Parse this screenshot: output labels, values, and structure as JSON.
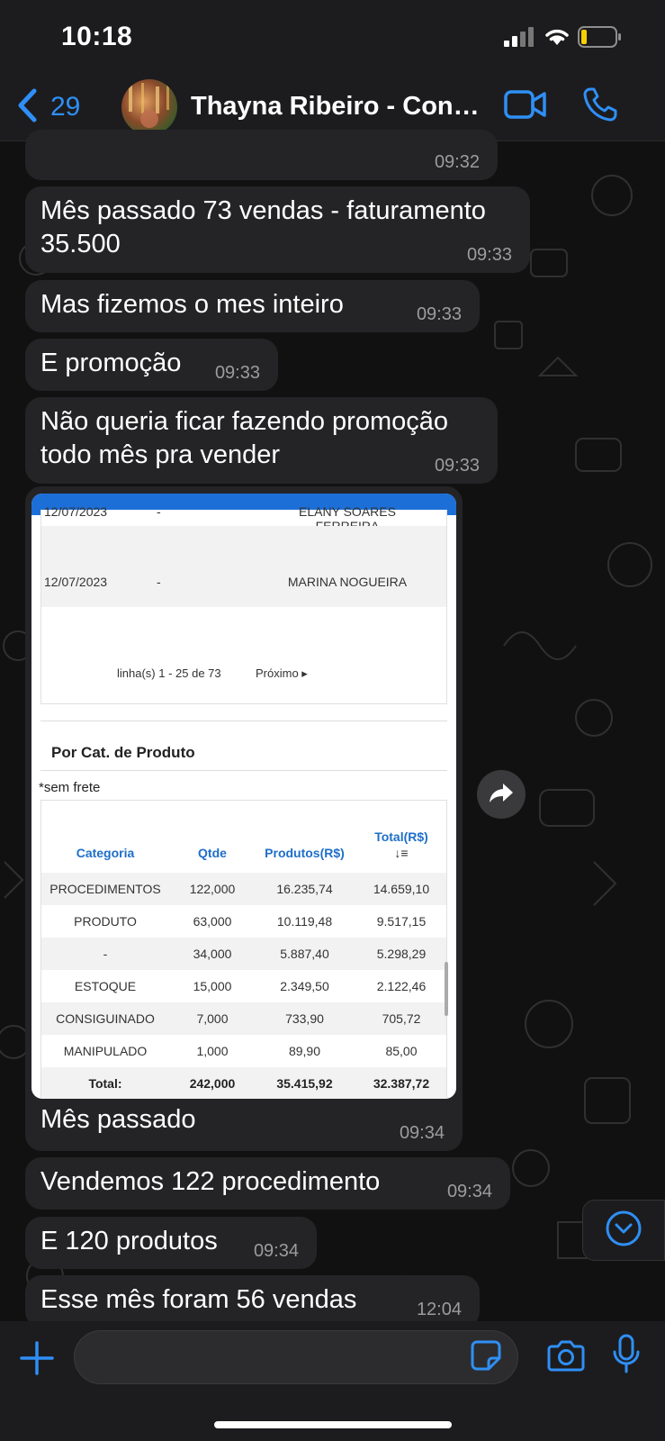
{
  "status_bar": {
    "time": "10:18"
  },
  "header": {
    "back_count": "29",
    "contact_name": "Thayna Ribeiro - Consultora"
  },
  "messages": [
    {
      "text": "",
      "time": "09:32"
    },
    {
      "text": "Mês passado 73 vendas - faturamento 35.500",
      "time": "09:33"
    },
    {
      "text": "Mas fizemos o mes inteiro",
      "time": "09:33"
    },
    {
      "text": "E promoção",
      "time": "09:33"
    },
    {
      "text": "Não queria ficar fazendo promoção todo mês pra vender",
      "time": "09:33"
    },
    {
      "text": "Mês passado",
      "time": "09:34"
    },
    {
      "text": "Vendemos 122 procedimento",
      "time": "09:34"
    },
    {
      "text": "E 120 produtos",
      "time": "09:34"
    },
    {
      "text": "Esse mês foram 56 vendas",
      "time": "12:04"
    }
  ],
  "screenshot": {
    "rows": [
      {
        "date": "12/07/2023",
        "dash": "-",
        "name": "ELANY SOARES FERREIRA"
      },
      {
        "date": "12/07/2023",
        "dash": "-",
        "name": "MARINA NOGUEIRA"
      }
    ],
    "pager_text": "linha(s) 1 - 25 de 73",
    "pager_next": "Próximo ▸",
    "section_title": "Por Cat. de Produto",
    "note": "*sem frete",
    "table": {
      "headers": [
        "Categoria",
        "Qtde",
        "Produtos(R$)",
        "Total(R$)"
      ],
      "sort_glyph": "↓≡",
      "rows": [
        [
          "PROCEDIMENTOS",
          "122,000",
          "16.235,74",
          "14.659,10"
        ],
        [
          "PRODUTO",
          "63,000",
          "10.119,48",
          "9.517,15"
        ],
        [
          "-",
          "34,000",
          "5.887,40",
          "5.298,29"
        ],
        [
          "ESTOQUE",
          "15,000",
          "2.349,50",
          "2.122,46"
        ],
        [
          "CONSIGUINADO",
          "7,000",
          "733,90",
          "705,72"
        ],
        [
          "MANIPULADO",
          "1,000",
          "89,90",
          "85,00"
        ]
      ],
      "total": [
        "Total:",
        "242,000",
        "35.415,92",
        "32.387,72"
      ]
    }
  },
  "input": {
    "placeholder": ""
  },
  "colors": {
    "accent": "#2f8ff5",
    "bubble": "#242426",
    "header": "#1c1c1e"
  }
}
